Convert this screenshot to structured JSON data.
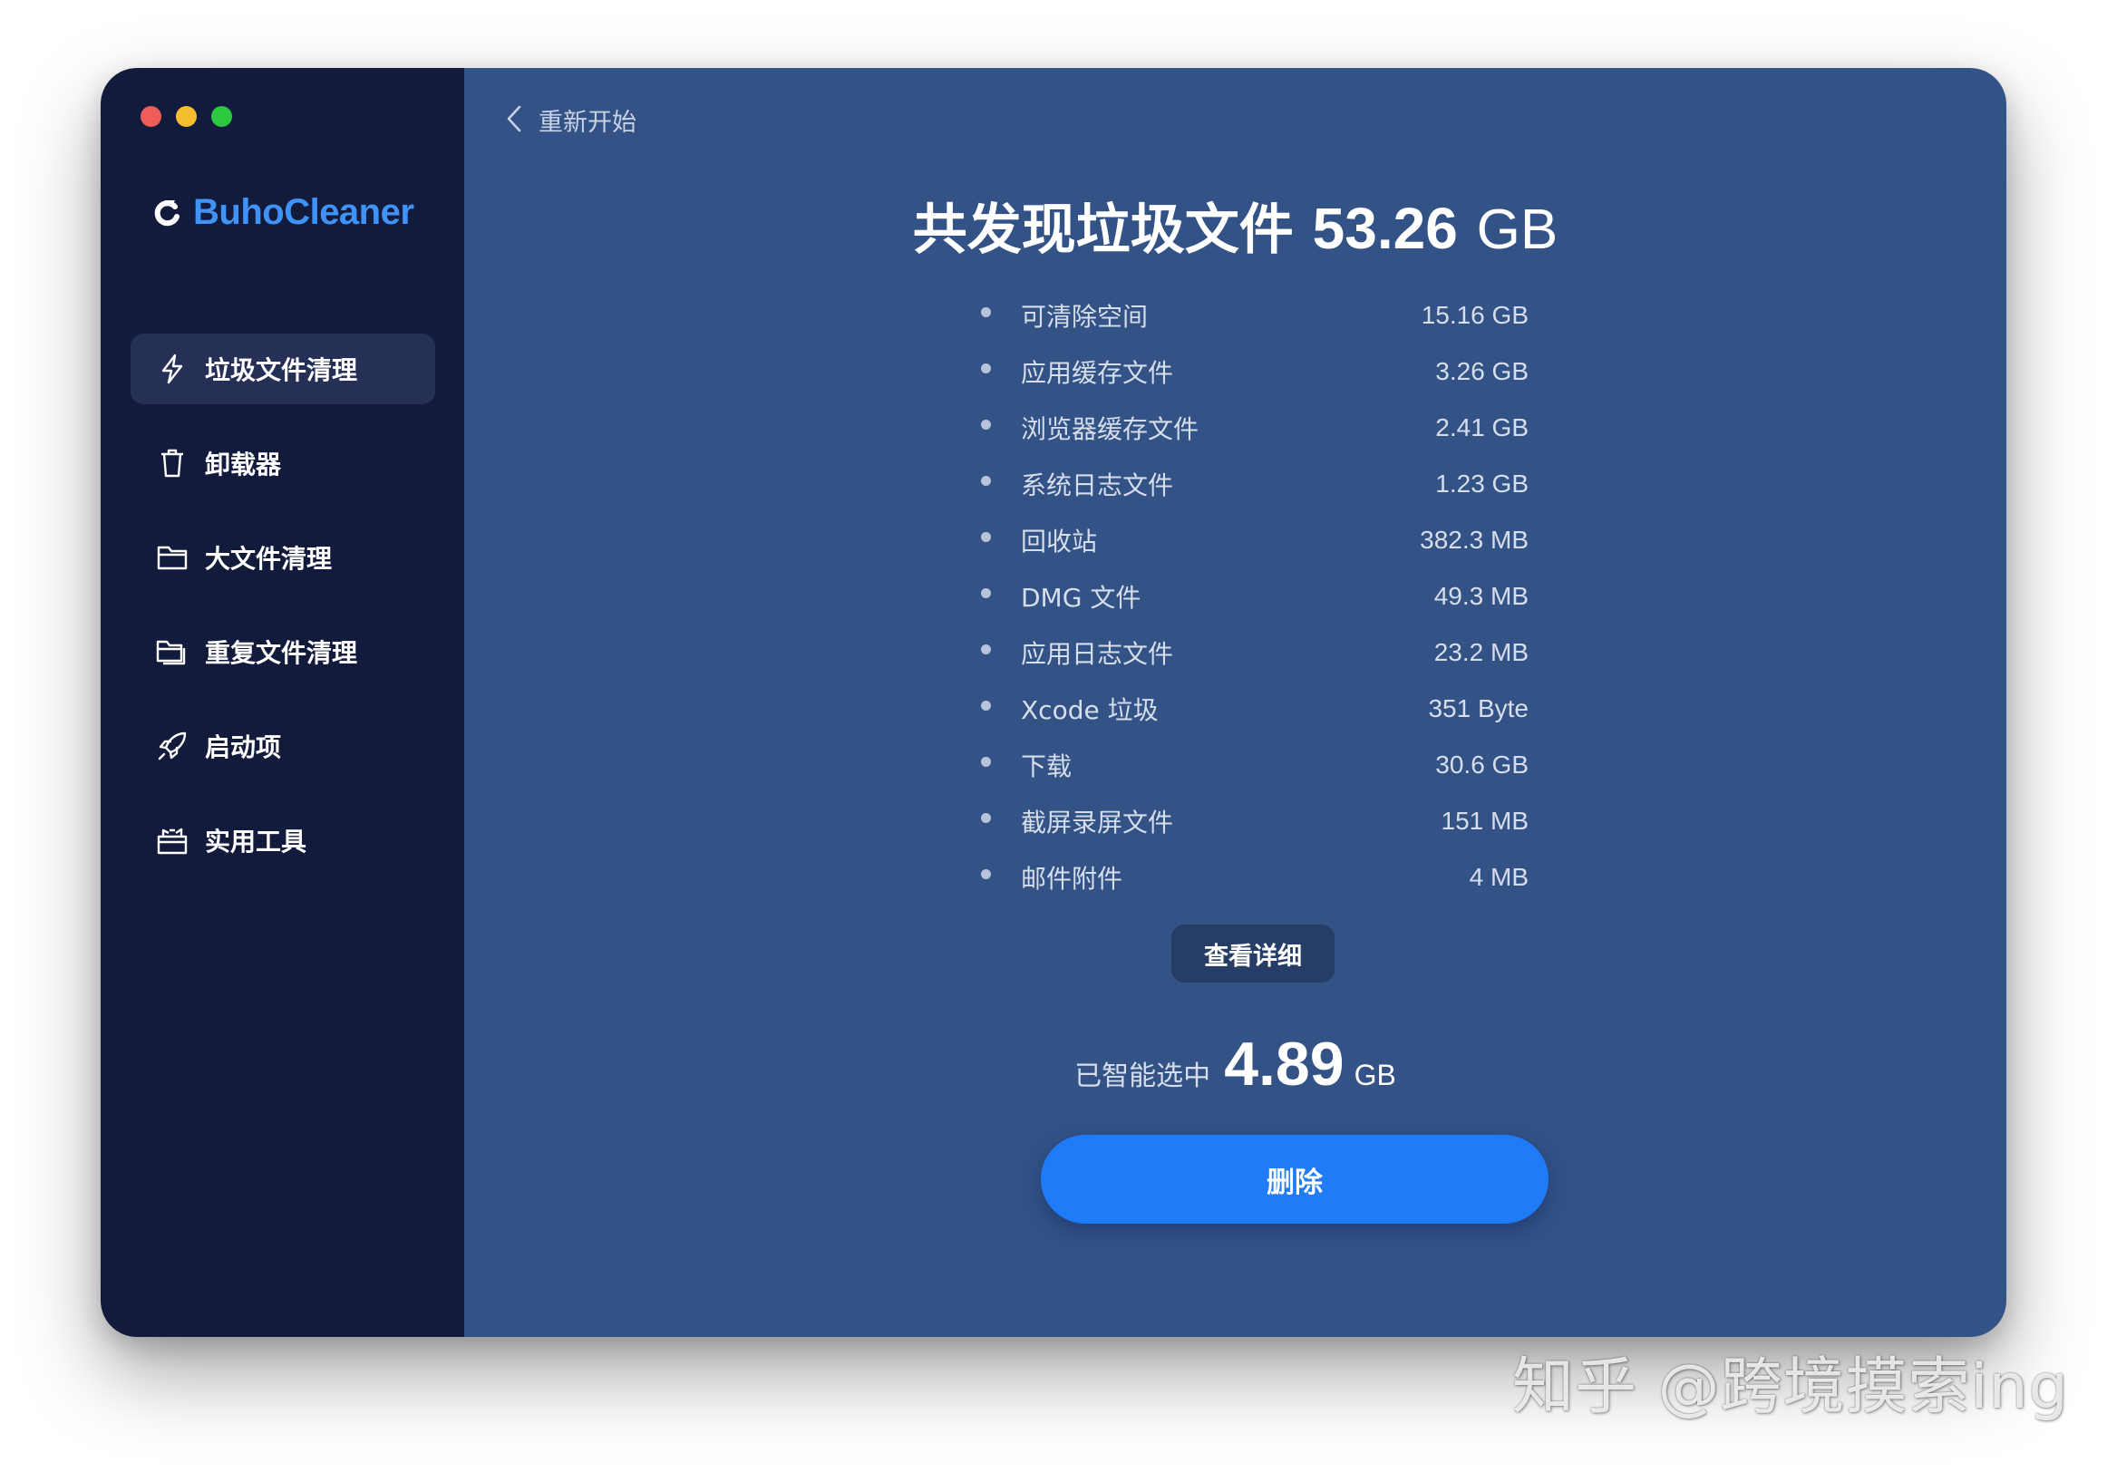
{
  "app": {
    "name": "BuhoCleaner"
  },
  "sidebar": {
    "items": [
      {
        "label": "垃圾文件清理",
        "icon": "bolt-icon",
        "active": true
      },
      {
        "label": "卸载器",
        "icon": "trash-icon",
        "active": false
      },
      {
        "label": "大文件清理",
        "icon": "folder-icon",
        "active": false
      },
      {
        "label": "重复文件清理",
        "icon": "duplicate-folder-icon",
        "active": false
      },
      {
        "label": "启动项",
        "icon": "rocket-icon",
        "active": false
      },
      {
        "label": "实用工具",
        "icon": "toolbox-icon",
        "active": false
      }
    ]
  },
  "header": {
    "back_label": "重新开始"
  },
  "summary": {
    "title_prefix": "共发现垃圾文件",
    "total_amount": "53.26",
    "total_unit": "GB"
  },
  "junk_items": [
    {
      "name": "可清除空间",
      "size": "15.16 GB"
    },
    {
      "name": "应用缓存文件",
      "size": "3.26 GB"
    },
    {
      "name": "浏览器缓存文件",
      "size": "2.41 GB"
    },
    {
      "name": "系统日志文件",
      "size": "1.23 GB"
    },
    {
      "name": "回收站",
      "size": "382.3 MB"
    },
    {
      "name": "DMG 文件",
      "size": "49.3 MB"
    },
    {
      "name": "应用日志文件",
      "size": "23.2 MB"
    },
    {
      "name": "Xcode 垃圾",
      "size": "351 Byte"
    },
    {
      "name": "下载",
      "size": "30.6 GB"
    },
    {
      "name": "截屏录屏文件",
      "size": "151 MB"
    },
    {
      "name": "邮件附件",
      "size": "4 MB"
    }
  ],
  "actions": {
    "details_label": "查看详细",
    "delete_label": "删除"
  },
  "selection": {
    "label": "已智能选中",
    "value": "4.89",
    "unit": "GB"
  },
  "watermark": "知乎 @跨境摸索ing",
  "colors": {
    "sidebar_bg": "#131b3c",
    "main_bg": "#335286",
    "brand": "#3f93f7",
    "delete_button": "#1f7bf6"
  }
}
